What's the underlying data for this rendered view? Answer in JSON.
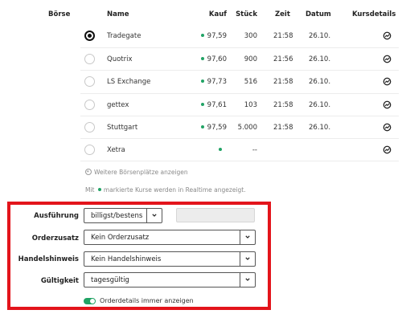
{
  "table": {
    "headers": {
      "boerse": "Börse",
      "name": "Name",
      "kauf": "Kauf",
      "stueck": "Stück",
      "zeit": "Zeit",
      "datum": "Datum",
      "kursdetails": "Kursdetails"
    },
    "rows": [
      {
        "name": "Tradegate",
        "kauf": "97,59",
        "stueck": "300",
        "zeit": "21:58",
        "datum": "26.10.",
        "selected": true
      },
      {
        "name": "Quotrix",
        "kauf": "97,60",
        "stueck": "900",
        "zeit": "21:56",
        "datum": "26.10.",
        "selected": false
      },
      {
        "name": "LS Exchange",
        "kauf": "97,73",
        "stueck": "516",
        "zeit": "21:58",
        "datum": "26.10.",
        "selected": false
      },
      {
        "name": "gettex",
        "kauf": "97,61",
        "stueck": "103",
        "zeit": "21:58",
        "datum": "26.10.",
        "selected": false
      },
      {
        "name": "Stuttgart",
        "kauf": "97,59",
        "stueck": "5.000",
        "zeit": "21:58",
        "datum": "26.10.",
        "selected": false
      },
      {
        "name": "Xetra",
        "kauf": "",
        "stueck": "--",
        "zeit": "",
        "datum": "",
        "selected": false
      }
    ],
    "more_label": "Weitere Börsenplätze anzeigen",
    "note_prefix": "Mit",
    "note_suffix": "markierte Kurse werden in Realtime angezeigt."
  },
  "order": {
    "ausfuehrung_label": "Ausführung",
    "ausfuehrung_value": "billigst/bestens",
    "orderzusatz_label": "Orderzusatz",
    "orderzusatz_value": "Kein Orderzusatz",
    "handelshinweis_label": "Handelshinweis",
    "handelshinweis_value": "Kein Handelshinweis",
    "gueltigkeit_label": "Gültigkeit",
    "gueltigkeit_value": "tagesgültig",
    "toggle_label": "Orderdetails immer anzeigen",
    "toggle_on": true
  },
  "colors": {
    "realtime_dot": "#21a365",
    "highlight_border": "#e3141b",
    "toggle_on": "#21a365"
  },
  "icons": {
    "kursdetails": "chart-icon",
    "more": "plus-circle-icon",
    "dropdown": "chevron-down-icon"
  }
}
